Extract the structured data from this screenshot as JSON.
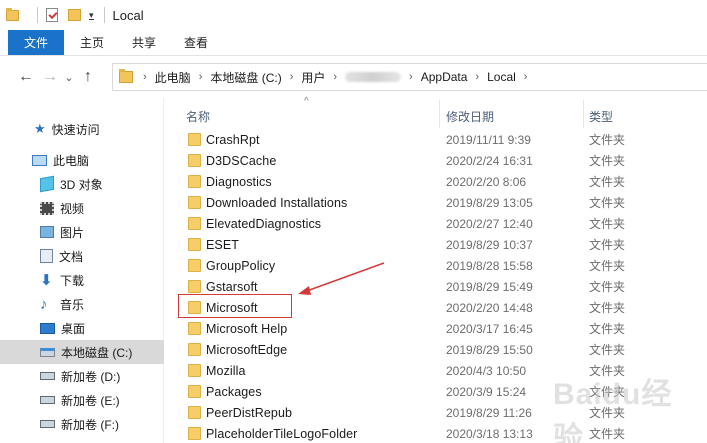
{
  "window": {
    "title": "Local"
  },
  "ribbon": {
    "tabs": [
      "文件",
      "主页",
      "共享",
      "查看"
    ]
  },
  "address": {
    "crumbs": [
      "此电脑",
      "本地磁盘 (C:)",
      "用户",
      "",
      "AppData",
      "Local"
    ]
  },
  "nav": {
    "items": [
      {
        "label": "快速访问",
        "icon": "star-icon"
      },
      {
        "label": "此电脑",
        "icon": "computer-icon"
      },
      {
        "label": "3D 对象",
        "icon": "cube-icon"
      },
      {
        "label": "视频",
        "icon": "video-icon"
      },
      {
        "label": "图片",
        "icon": "pictures-icon"
      },
      {
        "label": "文档",
        "icon": "documents-icon"
      },
      {
        "label": "下载",
        "icon": "download-icon"
      },
      {
        "label": "音乐",
        "icon": "music-icon"
      },
      {
        "label": "桌面",
        "icon": "desktop-icon"
      },
      {
        "label": "本地磁盘 (C:)",
        "icon": "drive-icon"
      },
      {
        "label": "新加卷 (D:)",
        "icon": "drive-icon"
      },
      {
        "label": "新加卷 (E:)",
        "icon": "drive-icon"
      },
      {
        "label": "新加卷 (F:)",
        "icon": "drive-icon"
      }
    ]
  },
  "columns": {
    "name": "名称",
    "date": "修改日期",
    "type": "类型"
  },
  "files": [
    {
      "name": "CrashRpt",
      "date": "2019/11/11 9:39",
      "type": "文件夹"
    },
    {
      "name": "D3DSCache",
      "date": "2020/2/24 16:31",
      "type": "文件夹"
    },
    {
      "name": "Diagnostics",
      "date": "2020/2/20 8:06",
      "type": "文件夹"
    },
    {
      "name": "Downloaded Installations",
      "date": "2019/8/29 13:05",
      "type": "文件夹"
    },
    {
      "name": "ElevatedDiagnostics",
      "date": "2020/2/27 12:40",
      "type": "文件夹"
    },
    {
      "name": "ESET",
      "date": "2019/8/29 10:37",
      "type": "文件夹"
    },
    {
      "name": "GroupPolicy",
      "date": "2019/8/28 15:58",
      "type": "文件夹"
    },
    {
      "name": "Gstarsoft",
      "date": "2019/8/29 15:49",
      "type": "文件夹"
    },
    {
      "name": "Microsoft",
      "date": "2020/2/20 14:48",
      "type": "文件夹"
    },
    {
      "name": "Microsoft Help",
      "date": "2020/3/17 16:45",
      "type": "文件夹"
    },
    {
      "name": "MicrosoftEdge",
      "date": "2019/8/29 15:50",
      "type": "文件夹"
    },
    {
      "name": "Mozilla",
      "date": "2020/4/3 10:50",
      "type": "文件夹"
    },
    {
      "name": "Packages",
      "date": "2020/3/9 15:24",
      "type": "文件夹"
    },
    {
      "name": "PeerDistRepub",
      "date": "2019/8/29 11:26",
      "type": "文件夹"
    },
    {
      "name": "PlaceholderTileLogoFolder",
      "date": "2020/3/18 13:13",
      "type": "文件夹"
    }
  ],
  "watermark": "Baidu经验",
  "colors": {
    "accent": "#1a73c8",
    "highlight": "#d43a3a",
    "folder": "#f6ce67"
  }
}
